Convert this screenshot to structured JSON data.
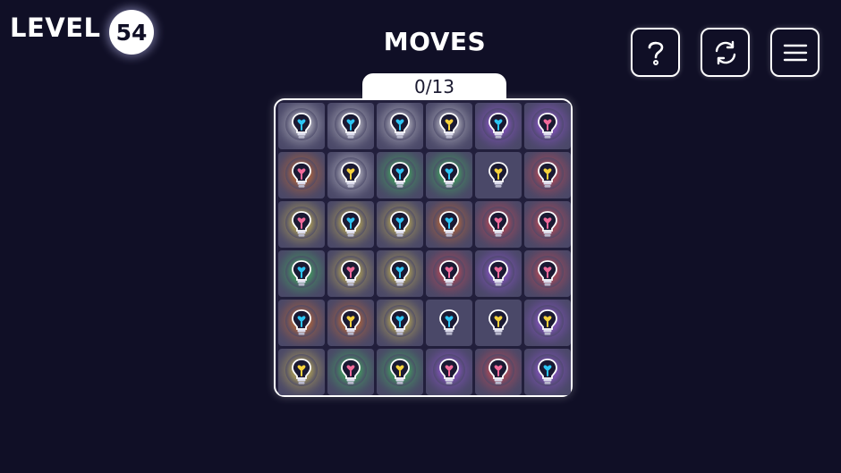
{
  "header": {
    "level_label": "LEVEL",
    "level_number": "54",
    "moves_title": "MOVES",
    "moves_counter": "0/13"
  },
  "buttons": [
    {
      "name": "help-button",
      "icon": "question-mark-icon"
    },
    {
      "name": "restart-button",
      "icon": "refresh-icon"
    },
    {
      "name": "menu-button",
      "icon": "hamburger-menu-icon"
    }
  ],
  "colors": {
    "background": "#100f26",
    "cell": "#4a4868",
    "board": "#221f3c",
    "blue": "#2cc6f5",
    "pink": "#f26a9b",
    "yellow": "#f7d23c",
    "glow_white": "#ffffff",
    "glow_purple": "#b05cff",
    "glow_orange": "#ff7a1a",
    "glow_green": "#3ee05a",
    "glow_yellow": "#ffe54a",
    "glow_red": "#ff4a4a",
    "glow_none": "none"
  },
  "board": {
    "rows": 6,
    "cols": 6,
    "cells": [
      [
        {
          "bulb": "blue",
          "glow": "white"
        },
        {
          "bulb": "blue",
          "glow": "white"
        },
        {
          "bulb": "blue",
          "glow": "white"
        },
        {
          "bulb": "yellow",
          "glow": "white"
        },
        {
          "bulb": "blue",
          "glow": "purple"
        },
        {
          "bulb": "pink",
          "glow": "purple"
        }
      ],
      [
        {
          "bulb": "pink",
          "glow": "orange"
        },
        {
          "bulb": "yellow",
          "glow": "white"
        },
        {
          "bulb": "blue",
          "glow": "green"
        },
        {
          "bulb": "blue",
          "glow": "green"
        },
        {
          "bulb": "yellow",
          "glow": "none"
        },
        {
          "bulb": "yellow",
          "glow": "red"
        }
      ],
      [
        {
          "bulb": "pink",
          "glow": "yellow"
        },
        {
          "bulb": "blue",
          "glow": "yellow"
        },
        {
          "bulb": "blue",
          "glow": "yellow"
        },
        {
          "bulb": "blue",
          "glow": "orange"
        },
        {
          "bulb": "pink",
          "glow": "red"
        },
        {
          "bulb": "pink",
          "glow": "red"
        }
      ],
      [
        {
          "bulb": "blue",
          "glow": "green"
        },
        {
          "bulb": "pink",
          "glow": "yellow"
        },
        {
          "bulb": "blue",
          "glow": "yellow"
        },
        {
          "bulb": "pink",
          "glow": "red"
        },
        {
          "bulb": "pink",
          "glow": "purple"
        },
        {
          "bulb": "pink",
          "glow": "red"
        }
      ],
      [
        {
          "bulb": "blue",
          "glow": "orange"
        },
        {
          "bulb": "yellow",
          "glow": "orange"
        },
        {
          "bulb": "blue",
          "glow": "yellow"
        },
        {
          "bulb": "blue",
          "glow": "none"
        },
        {
          "bulb": "yellow",
          "glow": "none"
        },
        {
          "bulb": "yellow",
          "glow": "purple"
        }
      ],
      [
        {
          "bulb": "yellow",
          "glow": "yellow"
        },
        {
          "bulb": "pink",
          "glow": "green"
        },
        {
          "bulb": "yellow",
          "glow": "green"
        },
        {
          "bulb": "pink",
          "glow": "purple"
        },
        {
          "bulb": "pink",
          "glow": "red"
        },
        {
          "bulb": "blue",
          "glow": "purple"
        }
      ]
    ]
  }
}
